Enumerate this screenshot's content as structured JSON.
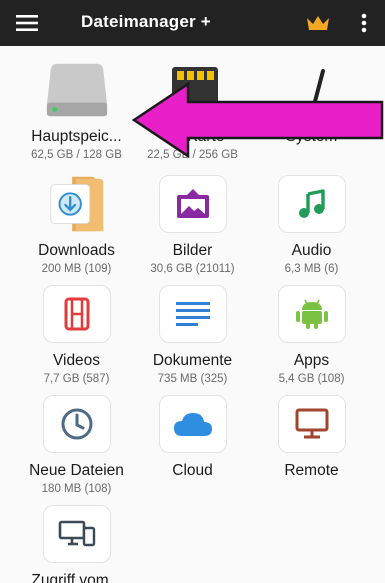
{
  "app_bar": {
    "title": "Dateimanager +",
    "menu_icon": "hamburger-menu-icon",
    "crown_icon": "crown-icon",
    "more_icon": "more-vert-icon"
  },
  "colors": {
    "app_bar": "#222222",
    "crown": "#f5a623",
    "arrow_fill": "#e81ec8",
    "arrow_stroke": "#1a1a1a"
  },
  "tiles": [
    {
      "label": "Hauptspeic...",
      "sub": "62,5 GB / 128 GB",
      "icon": "internal-storage-icon"
    },
    {
      "label": "SD-Karte",
      "sub": "22,5 GB / 256 GB",
      "icon": "sd-card-icon"
    },
    {
      "label": "System",
      "sub": "",
      "icon": "system-icon"
    },
    {
      "label": "Downloads",
      "sub": "200 MB (109)",
      "icon": "downloads-folder-icon"
    },
    {
      "label": "Bilder",
      "sub": "30,6 GB (21011)",
      "icon": "image-icon"
    },
    {
      "label": "Audio",
      "sub": "6,3 MB (6)",
      "icon": "music-note-icon"
    },
    {
      "label": "Videos",
      "sub": "7,7 GB (587)",
      "icon": "film-icon"
    },
    {
      "label": "Dokumente",
      "sub": "735 MB (325)",
      "icon": "document-icon"
    },
    {
      "label": "Apps",
      "sub": "5,4 GB (108)",
      "icon": "android-icon"
    },
    {
      "label": "Neue Dateien",
      "sub": "180 MB (108)",
      "icon": "clock-icon"
    },
    {
      "label": "Cloud",
      "sub": "",
      "icon": "cloud-icon"
    },
    {
      "label": "Remote",
      "sub": "",
      "icon": "monitor-icon"
    },
    {
      "label": "Zugriff vom...",
      "sub": "",
      "icon": "devices-icon"
    }
  ]
}
